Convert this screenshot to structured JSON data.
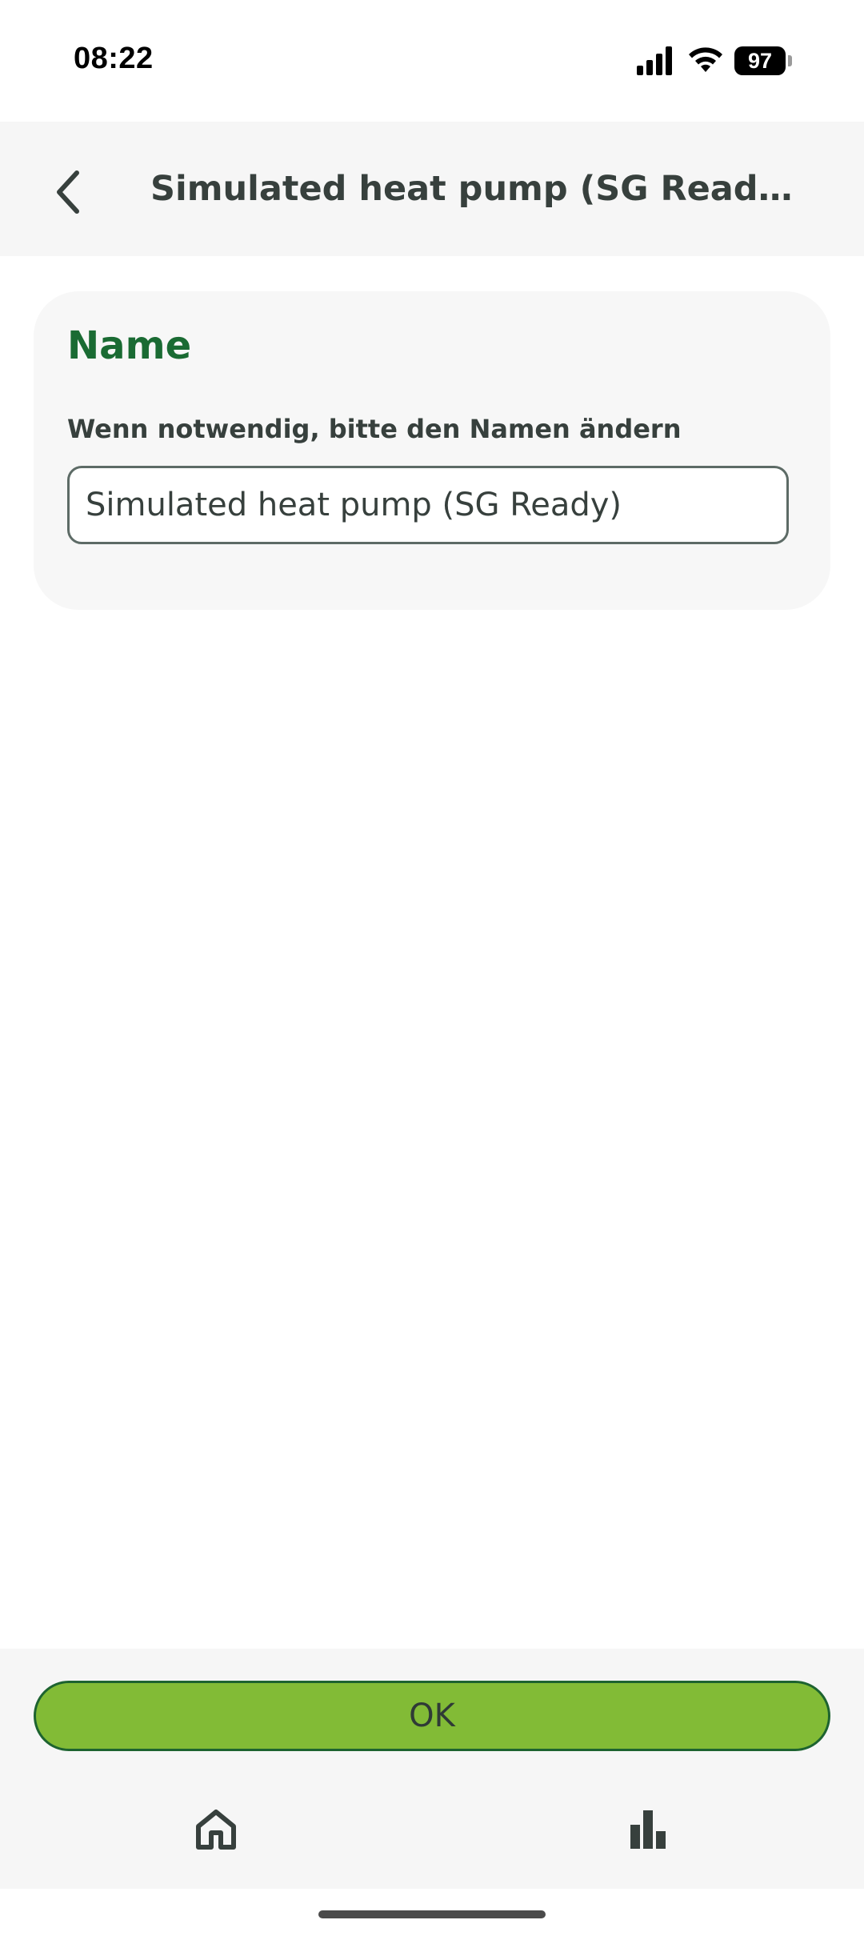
{
  "status_bar": {
    "time": "08:22",
    "battery": "97",
    "icons": [
      "signal-icon",
      "wifi-icon",
      "battery-icon"
    ]
  },
  "header": {
    "title": "Simulated heat pump (SG Ready)...",
    "back_icon": "chevron-left-icon"
  },
  "name_section": {
    "title": "Name",
    "label": "Wenn notwendig, bitte den Namen ändern",
    "input_value": "Simulated heat pump (SG Ready)"
  },
  "actions": {
    "ok_label": "OK"
  },
  "bottom_nav": {
    "items": [
      {
        "icon": "home-icon"
      },
      {
        "icon": "bar-chart-icon"
      }
    ]
  },
  "colors": {
    "accent_green": "#1a6b33",
    "button_green": "#82bb36",
    "panel_gray": "#f6f6f6",
    "text_dark": "#37403d"
  }
}
